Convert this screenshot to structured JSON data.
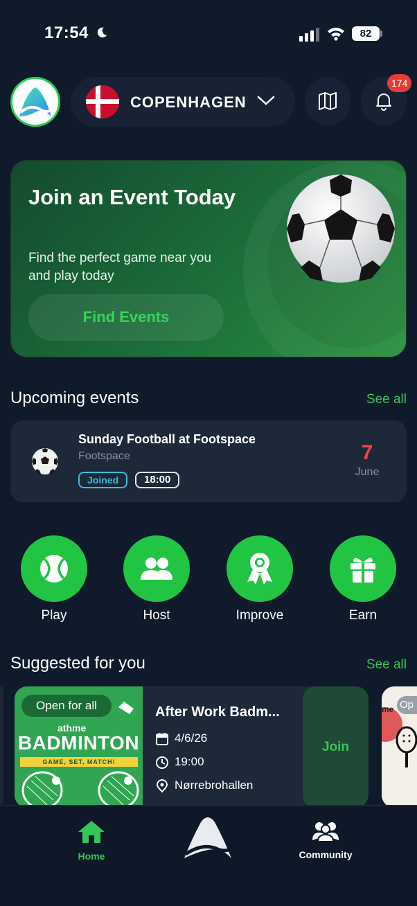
{
  "status_bar": {
    "time": "17:54",
    "battery": "82"
  },
  "header": {
    "city": "COPENHAGEN",
    "notifications_count": "174",
    "icons": {
      "logo": "app-logo",
      "flag": "denmark-flag",
      "chevron": "chevron-down-icon",
      "map": "map-icon",
      "bell": "bell-icon"
    }
  },
  "hero": {
    "title": "Join an Event Today",
    "subtitle": "Find the perfect game near you and play today",
    "button": "Find Events"
  },
  "upcoming": {
    "title": "Upcoming events",
    "see_all": "See all",
    "event": {
      "title": "Sunday Football at Footspace",
      "venue": "Footspace",
      "status": "Joined",
      "time": "18:00",
      "day": "7",
      "month": "June"
    }
  },
  "actions": [
    {
      "label": "Play",
      "icon": "tennis-ball-icon"
    },
    {
      "label": "Host",
      "icon": "users-icon"
    },
    {
      "label": "Improve",
      "icon": "award-ribbon-icon"
    },
    {
      "label": "Earn",
      "icon": "gift-icon"
    }
  ],
  "suggested": {
    "title": "Suggested for you",
    "see_all": "See all",
    "card": {
      "tag": "Open for all",
      "brand": "athme",
      "banner_title": "BADMINTON",
      "banner_sub": "GAME, SET, MATCH!",
      "title": "After Work Badm...",
      "date": "4/6/26",
      "time": "19:00",
      "location": "Nørrebrohallen",
      "join": "Join"
    },
    "next_peek": {
      "brand": "me",
      "tag": "Op"
    }
  },
  "bottom_nav": {
    "home": "Home",
    "community": "Community"
  },
  "colors": {
    "accent": "#22c444",
    "background": "#0f1a2b",
    "card": "#1d2838",
    "danger": "#e53b3b"
  }
}
